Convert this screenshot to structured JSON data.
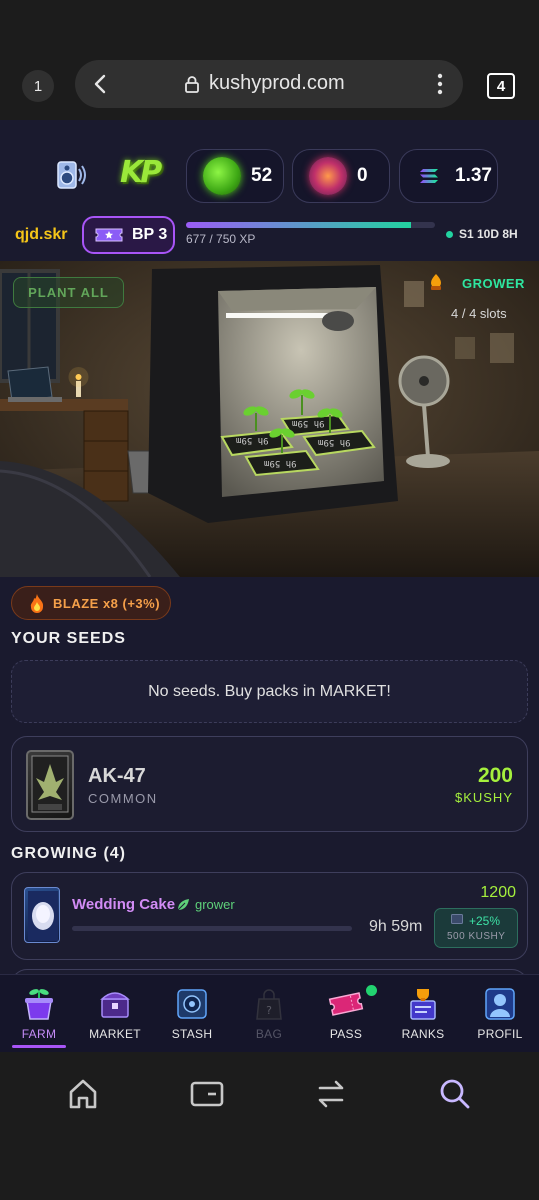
{
  "browser": {
    "tab_number": "1",
    "url": "kushyprod.com",
    "tabs_count": "4"
  },
  "header": {
    "kp_logo_text": "KP",
    "kp_balance": "52",
    "chip_balance": "0",
    "sol_balance": "1.37",
    "username": "qjd.skr",
    "bp_label": "BP 3",
    "xp_text": "677 / 750 XP",
    "xp_progress": 0.9027,
    "season": "S1 10D 8H"
  },
  "room": {
    "plant_all_label": "PLANT ALL",
    "role_label": "GROWER",
    "slots_label": "4 / 4 slots",
    "pot_timers": [
      "9h 59m",
      "9h 59m",
      "9h 59m",
      "9h 59m"
    ]
  },
  "blaze": {
    "label": "BLAZE x8 (+3%)"
  },
  "seeds": {
    "title": "YOUR SEEDS",
    "empty_message": "No seeds. Buy packs in MARKET!"
  },
  "offer": {
    "name": "AK-47",
    "rarity": "COMMON",
    "price": "200",
    "currency": "$KUSHY",
    "card_label": "AK-47"
  },
  "growing": {
    "title": "GROWING (4)",
    "items": [
      {
        "name": "Wedding Cake",
        "type": "grower",
        "timer": "9h 59m",
        "value": "1200",
        "bonus_pct": "+25%",
        "bonus_kushy": "500  KUSHY",
        "progress": 0.0
      }
    ]
  },
  "nav": {
    "items": [
      {
        "label": "FARM",
        "icon": "plant-pot-icon"
      },
      {
        "label": "MARKET",
        "icon": "chest-icon"
      },
      {
        "label": "STASH",
        "icon": "vault-icon"
      },
      {
        "label": "BAG",
        "icon": "bag-icon"
      },
      {
        "label": "PASS",
        "icon": "ticket-icon"
      },
      {
        "label": "RANKS",
        "icon": "trophy-icon"
      },
      {
        "label": "PROFIL",
        "icon": "profile-icon"
      }
    ]
  },
  "colors": {
    "accent_purple": "#a855f7",
    "accent_green": "#a5f03d",
    "teal": "#22d3a0",
    "gold": "#f5c518",
    "background": "#1a1a2e"
  }
}
